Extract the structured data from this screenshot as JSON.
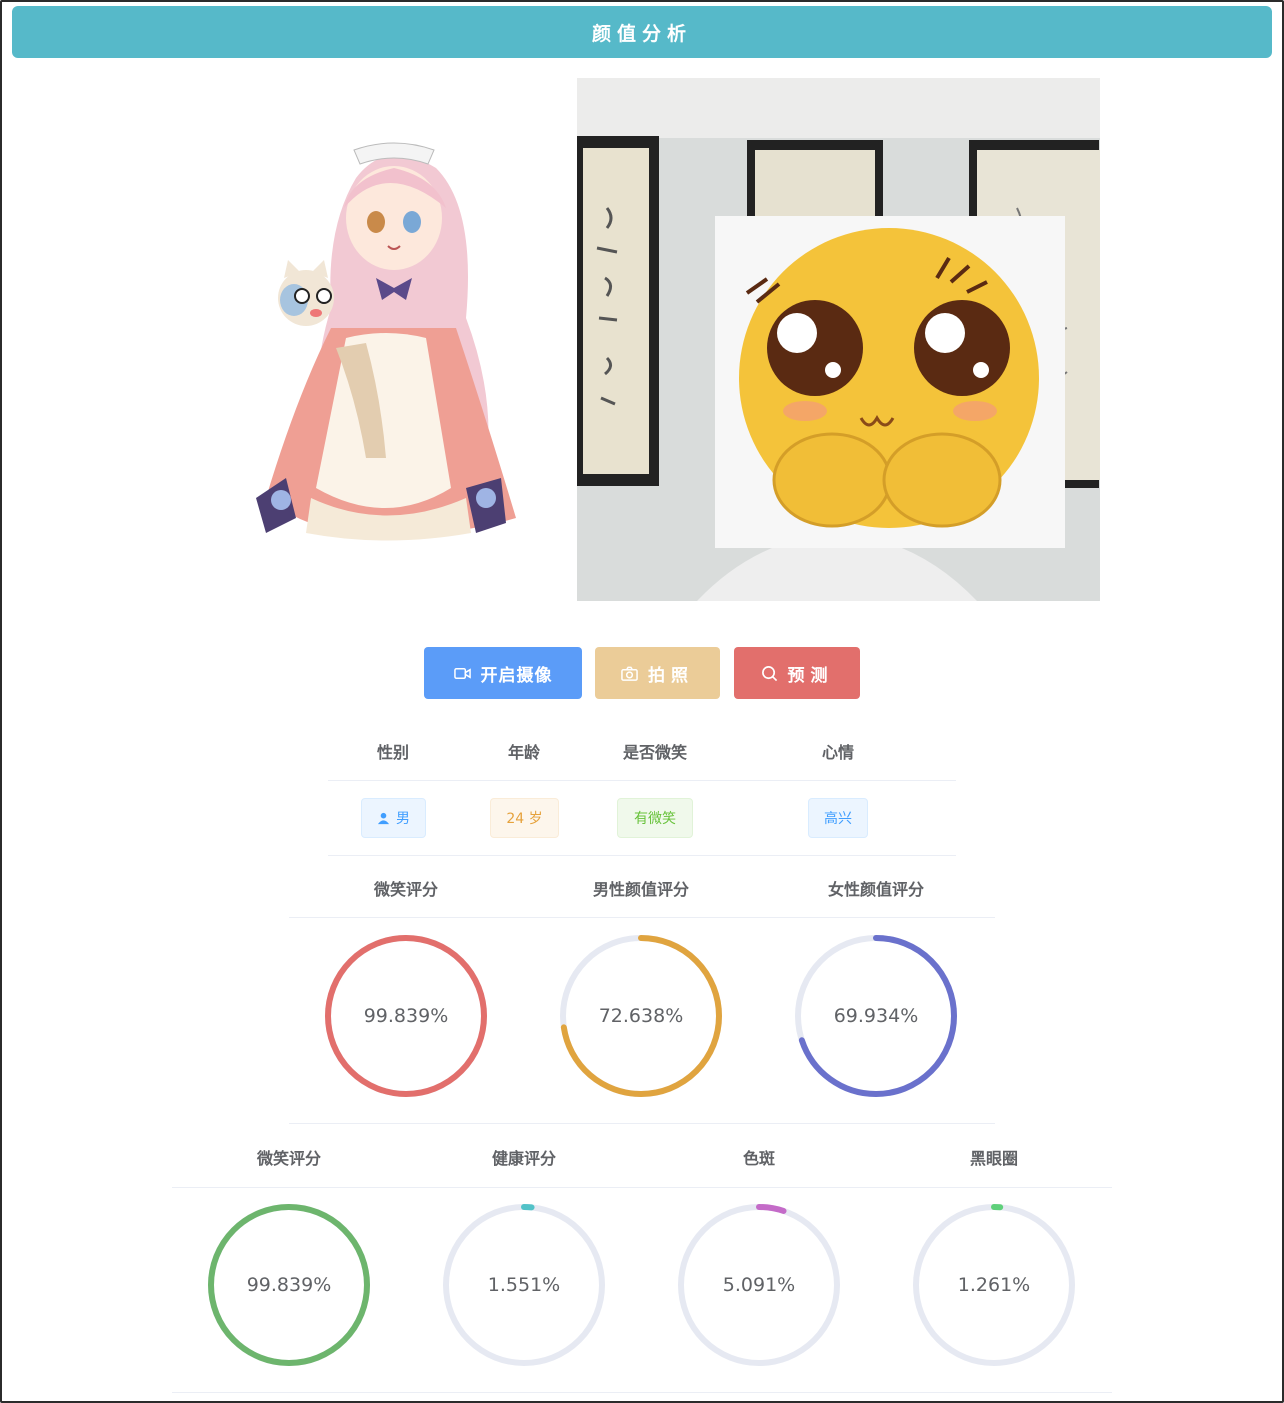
{
  "header": {
    "title": "颜值分析"
  },
  "buttons": {
    "camera": "开启摄像",
    "photo": "拍照",
    "predict": "预测"
  },
  "attributes": {
    "headers": [
      "性别",
      "年龄",
      "是否微笑",
      "心情"
    ],
    "gender": "男",
    "age": "24 岁",
    "smile": "有微笑",
    "mood": "高兴"
  },
  "scores_row1": {
    "headers": [
      "微笑评分",
      "男性颜值评分",
      "女性颜值评分"
    ],
    "items": [
      {
        "label": "99.839%",
        "value": 99.839,
        "color": "#e26f6c"
      },
      {
        "label": "72.638%",
        "value": 72.638,
        "color": "#e0a43f"
      },
      {
        "label": "69.934%",
        "value": 69.934,
        "color": "#6a71cc"
      }
    ]
  },
  "scores_row2": {
    "headers": [
      "微笑评分",
      "健康评分",
      "色斑",
      "黑眼圈"
    ],
    "items": [
      {
        "label": "99.839%",
        "value": 99.839,
        "color": "#6db56d"
      },
      {
        "label": "1.551%",
        "value": 1.551,
        "color": "#52c2c8"
      },
      {
        "label": "5.091%",
        "value": 5.091,
        "color": "#c46bc8"
      },
      {
        "label": "1.261%",
        "value": 1.261,
        "color": "#5fd07a"
      }
    ]
  },
  "colors": {
    "topbar": "#56b9c9",
    "track": "#e6e9f2"
  }
}
